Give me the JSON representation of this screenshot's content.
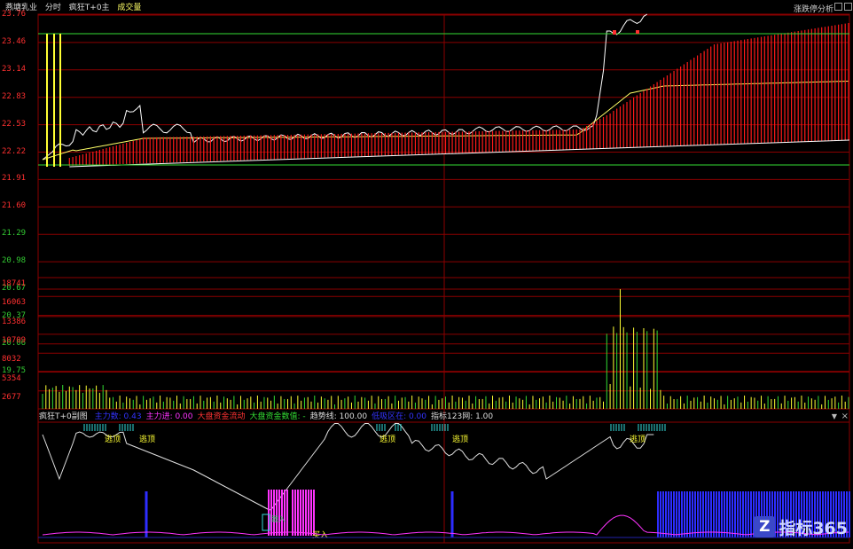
{
  "header": {
    "stock_name": "燕塘乳业",
    "mode": "分时",
    "indicator": "疯狂T+0主",
    "volume_label": "成交量",
    "right_title": "涨跌停分析"
  },
  "colors": {
    "bg": "#000000",
    "grid": "#8b0000",
    "price_label": "#ff3030",
    "low_label": "#33cc33",
    "volume_label": "#ff3030",
    "price_line": "#ffffff",
    "avg_line": "#ffff66",
    "fill_red": "#ff1a1a",
    "yellow": "#ffff33",
    "green": "#33dd33",
    "cyan": "#33dddd",
    "magenta": "#ff33ff",
    "blue": "#2d2dff"
  },
  "price_axis": {
    "labels": [
      "23.76",
      "23.46",
      "23.14",
      "22.83",
      "22.53",
      "22.22",
      "21.91",
      "21.60",
      "21.29",
      "20.98",
      "20.67",
      "20.37",
      "20.06",
      "19.75"
    ],
    "red_count": 8
  },
  "volume_axis": {
    "labels": [
      "18741",
      "16063",
      "13386",
      "10709",
      "8032",
      "5354",
      "2677"
    ]
  },
  "panel2": {
    "title": "疯狂T+0副图",
    "items": [
      {
        "text": "主力数: 0.43",
        "color": "#3333ff"
      },
      {
        "text": "主力进: 0.00",
        "color": "#ff33ff"
      },
      {
        "text": "大盘资金流动",
        "color": "#ff3333"
      },
      {
        "text": "大盘资金数值: -",
        "color": "#33dd33"
      },
      {
        "text": "趋势线: 100.00",
        "color": "#dddddd"
      },
      {
        "text": "低吸区在: 0.00",
        "color": "#3333ff"
      },
      {
        "text": "指标123网: 1.00",
        "color": "#dddddd"
      }
    ],
    "labels": {
      "top_sell": "逃顶",
      "buy": "买入",
      "follow": "跟入"
    }
  },
  "logo": {
    "text": "指标365"
  }
}
